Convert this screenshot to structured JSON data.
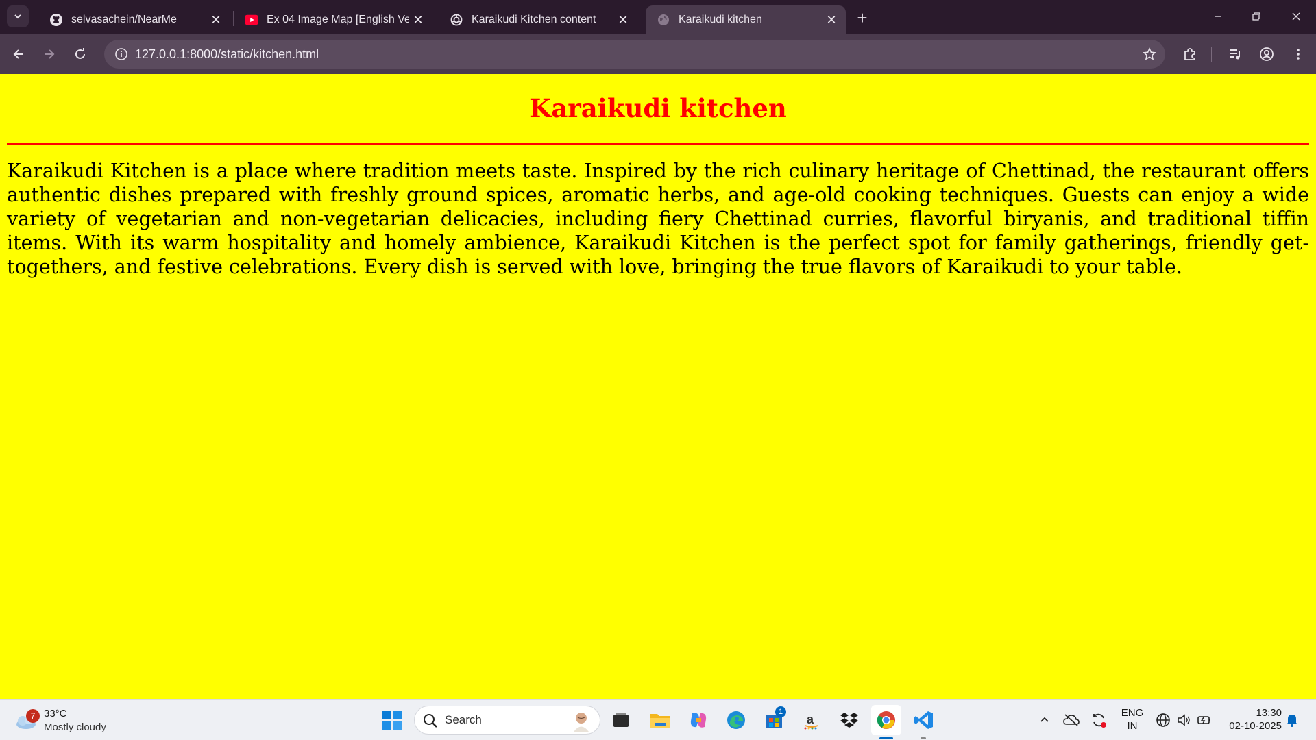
{
  "browser": {
    "tabs": [
      {
        "title": "selvasachein/NearMe",
        "icon": "github-icon"
      },
      {
        "title": "Ex 04 Image Map [English Versi",
        "icon": "youtube-icon"
      },
      {
        "title": "Karaikudi Kitchen content",
        "icon": "chatgpt-icon"
      },
      {
        "title": "Karaikudi kitchen",
        "icon": "globe-icon",
        "active": true
      }
    ],
    "url": "127.0.0.1:8000/static/kitchen.html"
  },
  "page": {
    "heading": "Karaikudi kitchen",
    "paragraph": "Karaikudi Kitchen is a place where tradition meets taste. Inspired by the rich culinary heritage of Chettinad, the restaurant offers authentic dishes prepared with freshly ground spices, aromatic herbs, and age-old cooking techniques. Guests can enjoy a wide variety of vegetarian and non-vegetarian delicacies, including fiery Chettinad curries, flavorful biryanis, and traditional tiffin items. With its warm hospitality and homely ambience, Karaikudi Kitchen is the perfect spot for family gatherings, friendly get-togethers, and festive celebrations. Every dish is served with love, bringing the true flavors of Karaikudi to your table.",
    "colors": {
      "background": "#ffff00",
      "heading": "#ff0000",
      "rule": "#ff0000",
      "text": "#000000"
    }
  },
  "taskbar": {
    "weather": {
      "badge": "7",
      "temp": "33°C",
      "condition": "Mostly cloudy"
    },
    "search_label": "Search",
    "store_badge": "1",
    "language": {
      "line1": "ENG",
      "line2": "IN"
    },
    "time": "13:30",
    "date": "02-10-2025"
  }
}
